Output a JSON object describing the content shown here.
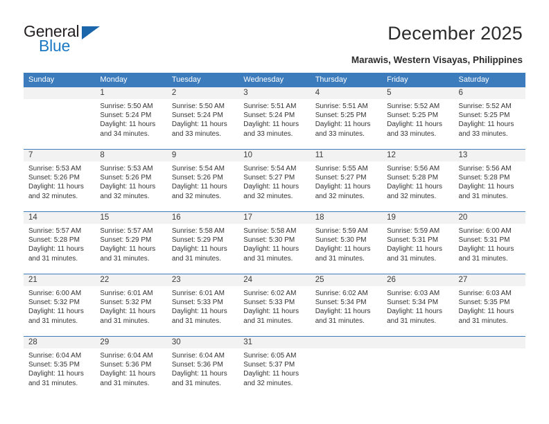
{
  "brand": {
    "name_part1": "General",
    "name_part2": "Blue",
    "logo_icon": "triangle-logo-icon",
    "accent_color": "#1b79c4"
  },
  "header": {
    "title": "December 2025",
    "subtitle": "Marawis, Western Visayas, Philippines"
  },
  "theme": {
    "header_row_bg": "#3c7cbd",
    "daynum_band_bg": "#f2f2f2",
    "text_color": "#333333"
  },
  "weekdays": [
    "Sunday",
    "Monday",
    "Tuesday",
    "Wednesday",
    "Thursday",
    "Friday",
    "Saturday"
  ],
  "labels": {
    "sunrise_prefix": "Sunrise:",
    "sunset_prefix": "Sunset:",
    "daylight_prefix": "Daylight:"
  },
  "weeks": [
    [
      {
        "day": "",
        "empty": true,
        "sunrise": "",
        "sunset": "",
        "daylight_line1": "",
        "daylight_line2": ""
      },
      {
        "day": "1",
        "empty": false,
        "sunrise": "Sunrise: 5:50 AM",
        "sunset": "Sunset: 5:24 PM",
        "daylight_line1": "Daylight: 11 hours",
        "daylight_line2": "and 34 minutes."
      },
      {
        "day": "2",
        "empty": false,
        "sunrise": "Sunrise: 5:50 AM",
        "sunset": "Sunset: 5:24 PM",
        "daylight_line1": "Daylight: 11 hours",
        "daylight_line2": "and 33 minutes."
      },
      {
        "day": "3",
        "empty": false,
        "sunrise": "Sunrise: 5:51 AM",
        "sunset": "Sunset: 5:24 PM",
        "daylight_line1": "Daylight: 11 hours",
        "daylight_line2": "and 33 minutes."
      },
      {
        "day": "4",
        "empty": false,
        "sunrise": "Sunrise: 5:51 AM",
        "sunset": "Sunset: 5:25 PM",
        "daylight_line1": "Daylight: 11 hours",
        "daylight_line2": "and 33 minutes."
      },
      {
        "day": "5",
        "empty": false,
        "sunrise": "Sunrise: 5:52 AM",
        "sunset": "Sunset: 5:25 PM",
        "daylight_line1": "Daylight: 11 hours",
        "daylight_line2": "and 33 minutes."
      },
      {
        "day": "6",
        "empty": false,
        "sunrise": "Sunrise: 5:52 AM",
        "sunset": "Sunset: 5:25 PM",
        "daylight_line1": "Daylight: 11 hours",
        "daylight_line2": "and 33 minutes."
      }
    ],
    [
      {
        "day": "7",
        "empty": false,
        "sunrise": "Sunrise: 5:53 AM",
        "sunset": "Sunset: 5:26 PM",
        "daylight_line1": "Daylight: 11 hours",
        "daylight_line2": "and 32 minutes."
      },
      {
        "day": "8",
        "empty": false,
        "sunrise": "Sunrise: 5:53 AM",
        "sunset": "Sunset: 5:26 PM",
        "daylight_line1": "Daylight: 11 hours",
        "daylight_line2": "and 32 minutes."
      },
      {
        "day": "9",
        "empty": false,
        "sunrise": "Sunrise: 5:54 AM",
        "sunset": "Sunset: 5:26 PM",
        "daylight_line1": "Daylight: 11 hours",
        "daylight_line2": "and 32 minutes."
      },
      {
        "day": "10",
        "empty": false,
        "sunrise": "Sunrise: 5:54 AM",
        "sunset": "Sunset: 5:27 PM",
        "daylight_line1": "Daylight: 11 hours",
        "daylight_line2": "and 32 minutes."
      },
      {
        "day": "11",
        "empty": false,
        "sunrise": "Sunrise: 5:55 AM",
        "sunset": "Sunset: 5:27 PM",
        "daylight_line1": "Daylight: 11 hours",
        "daylight_line2": "and 32 minutes."
      },
      {
        "day": "12",
        "empty": false,
        "sunrise": "Sunrise: 5:56 AM",
        "sunset": "Sunset: 5:28 PM",
        "daylight_line1": "Daylight: 11 hours",
        "daylight_line2": "and 32 minutes."
      },
      {
        "day": "13",
        "empty": false,
        "sunrise": "Sunrise: 5:56 AM",
        "sunset": "Sunset: 5:28 PM",
        "daylight_line1": "Daylight: 11 hours",
        "daylight_line2": "and 31 minutes."
      }
    ],
    [
      {
        "day": "14",
        "empty": false,
        "sunrise": "Sunrise: 5:57 AM",
        "sunset": "Sunset: 5:28 PM",
        "daylight_line1": "Daylight: 11 hours",
        "daylight_line2": "and 31 minutes."
      },
      {
        "day": "15",
        "empty": false,
        "sunrise": "Sunrise: 5:57 AM",
        "sunset": "Sunset: 5:29 PM",
        "daylight_line1": "Daylight: 11 hours",
        "daylight_line2": "and 31 minutes."
      },
      {
        "day": "16",
        "empty": false,
        "sunrise": "Sunrise: 5:58 AM",
        "sunset": "Sunset: 5:29 PM",
        "daylight_line1": "Daylight: 11 hours",
        "daylight_line2": "and 31 minutes."
      },
      {
        "day": "17",
        "empty": false,
        "sunrise": "Sunrise: 5:58 AM",
        "sunset": "Sunset: 5:30 PM",
        "daylight_line1": "Daylight: 11 hours",
        "daylight_line2": "and 31 minutes."
      },
      {
        "day": "18",
        "empty": false,
        "sunrise": "Sunrise: 5:59 AM",
        "sunset": "Sunset: 5:30 PM",
        "daylight_line1": "Daylight: 11 hours",
        "daylight_line2": "and 31 minutes."
      },
      {
        "day": "19",
        "empty": false,
        "sunrise": "Sunrise: 5:59 AM",
        "sunset": "Sunset: 5:31 PM",
        "daylight_line1": "Daylight: 11 hours",
        "daylight_line2": "and 31 minutes."
      },
      {
        "day": "20",
        "empty": false,
        "sunrise": "Sunrise: 6:00 AM",
        "sunset": "Sunset: 5:31 PM",
        "daylight_line1": "Daylight: 11 hours",
        "daylight_line2": "and 31 minutes."
      }
    ],
    [
      {
        "day": "21",
        "empty": false,
        "sunrise": "Sunrise: 6:00 AM",
        "sunset": "Sunset: 5:32 PM",
        "daylight_line1": "Daylight: 11 hours",
        "daylight_line2": "and 31 minutes."
      },
      {
        "day": "22",
        "empty": false,
        "sunrise": "Sunrise: 6:01 AM",
        "sunset": "Sunset: 5:32 PM",
        "daylight_line1": "Daylight: 11 hours",
        "daylight_line2": "and 31 minutes."
      },
      {
        "day": "23",
        "empty": false,
        "sunrise": "Sunrise: 6:01 AM",
        "sunset": "Sunset: 5:33 PM",
        "daylight_line1": "Daylight: 11 hours",
        "daylight_line2": "and 31 minutes."
      },
      {
        "day": "24",
        "empty": false,
        "sunrise": "Sunrise: 6:02 AM",
        "sunset": "Sunset: 5:33 PM",
        "daylight_line1": "Daylight: 11 hours",
        "daylight_line2": "and 31 minutes."
      },
      {
        "day": "25",
        "empty": false,
        "sunrise": "Sunrise: 6:02 AM",
        "sunset": "Sunset: 5:34 PM",
        "daylight_line1": "Daylight: 11 hours",
        "daylight_line2": "and 31 minutes."
      },
      {
        "day": "26",
        "empty": false,
        "sunrise": "Sunrise: 6:03 AM",
        "sunset": "Sunset: 5:34 PM",
        "daylight_line1": "Daylight: 11 hours",
        "daylight_line2": "and 31 minutes."
      },
      {
        "day": "27",
        "empty": false,
        "sunrise": "Sunrise: 6:03 AM",
        "sunset": "Sunset: 5:35 PM",
        "daylight_line1": "Daylight: 11 hours",
        "daylight_line2": "and 31 minutes."
      }
    ],
    [
      {
        "day": "28",
        "empty": false,
        "sunrise": "Sunrise: 6:04 AM",
        "sunset": "Sunset: 5:35 PM",
        "daylight_line1": "Daylight: 11 hours",
        "daylight_line2": "and 31 minutes."
      },
      {
        "day": "29",
        "empty": false,
        "sunrise": "Sunrise: 6:04 AM",
        "sunset": "Sunset: 5:36 PM",
        "daylight_line1": "Daylight: 11 hours",
        "daylight_line2": "and 31 minutes."
      },
      {
        "day": "30",
        "empty": false,
        "sunrise": "Sunrise: 6:04 AM",
        "sunset": "Sunset: 5:36 PM",
        "daylight_line1": "Daylight: 11 hours",
        "daylight_line2": "and 31 minutes."
      },
      {
        "day": "31",
        "empty": false,
        "sunrise": "Sunrise: 6:05 AM",
        "sunset": "Sunset: 5:37 PM",
        "daylight_line1": "Daylight: 11 hours",
        "daylight_line2": "and 32 minutes."
      },
      {
        "day": "",
        "empty": true,
        "sunrise": "",
        "sunset": "",
        "daylight_line1": "",
        "daylight_line2": ""
      },
      {
        "day": "",
        "empty": true,
        "sunrise": "",
        "sunset": "",
        "daylight_line1": "",
        "daylight_line2": ""
      },
      {
        "day": "",
        "empty": true,
        "sunrise": "",
        "sunset": "",
        "daylight_line1": "",
        "daylight_line2": ""
      }
    ]
  ]
}
